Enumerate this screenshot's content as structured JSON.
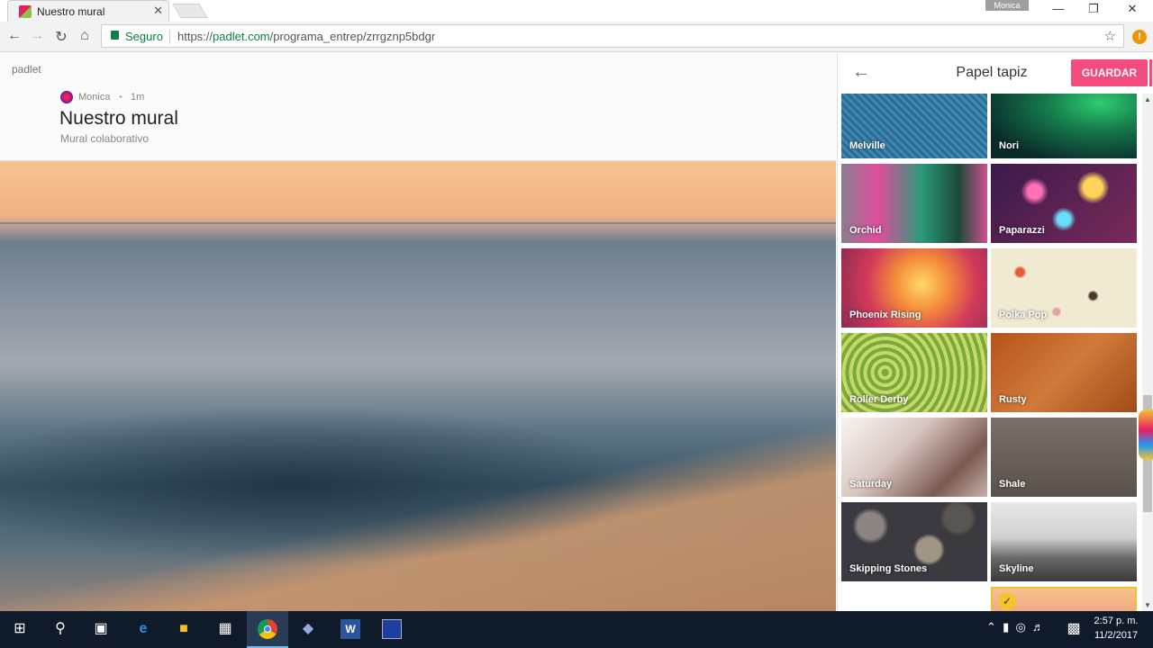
{
  "browser": {
    "tab_title": "Nuestro mural",
    "tab_close": "✕",
    "user_chip": "Monica",
    "secure_label": "Seguro",
    "url_scheme": "https://",
    "url_host": "padlet.com",
    "url_path": "/programa_entrep/zrrgznp5bdgr"
  },
  "padlet": {
    "logo": "padlet",
    "author": "Monica",
    "dot": "•",
    "time": "1m",
    "title": "Nuestro mural",
    "subtitle": "Mural colaborativo"
  },
  "panel": {
    "title": "Papel tapiz",
    "save_label": "GUARDAR",
    "wallpapers": [
      {
        "label": "Melville",
        "style": "melville"
      },
      {
        "label": "Nori",
        "style": "nori"
      },
      {
        "label": "Orchid",
        "style": "orchid"
      },
      {
        "label": "Paparazzi",
        "style": "paparazzi"
      },
      {
        "label": "Phoenix Rising",
        "style": "phoenix"
      },
      {
        "label": "Polka Pop",
        "style": "polka"
      },
      {
        "label": "Roller Derby",
        "style": "roller"
      },
      {
        "label": "Rusty",
        "style": "rusty"
      },
      {
        "label": "Saturday",
        "style": "saturday"
      },
      {
        "label": "Shale",
        "style": "shale"
      },
      {
        "label": "Skipping Stones",
        "style": "stones"
      },
      {
        "label": "Skyline",
        "style": "skyline"
      }
    ],
    "selected_check": "✓"
  },
  "taskbar": {
    "word_label": "W",
    "clock_time": "2:57 p. m.",
    "clock_date": "11/2/2017"
  },
  "colors": {
    "accent": "#f44c7f",
    "secure_green": "#0b8043",
    "taskbar": "#0f1a2b"
  },
  "icons": [
    "back-icon",
    "forward-icon",
    "reload-icon",
    "home-icon",
    "lock-icon",
    "star-icon",
    "windows-icon",
    "search-icon",
    "task-view-icon",
    "edge-icon",
    "file-explorer-icon",
    "store-icon",
    "chrome-icon"
  ]
}
